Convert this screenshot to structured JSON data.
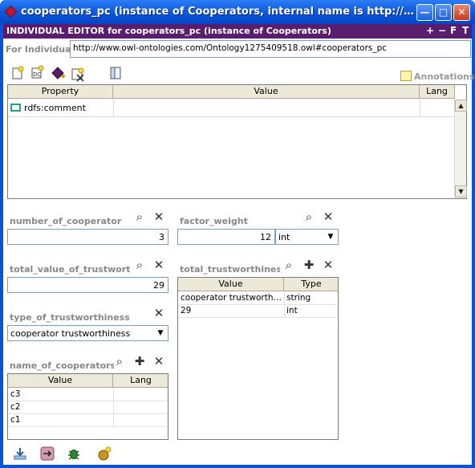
{
  "window": {
    "title": "cooperators_pc   (instance of Cooperators, internal name is http://www.owl-ontologies.com/Ontology1275409518.owl#cooperators_pc)",
    "minimize_glyph": "—",
    "maximize_glyph": "□",
    "close_glyph": "✕"
  },
  "editor": {
    "header_title": "INDIVIDUAL EDITOR for cooperators_pc   (instance of Cooperators)",
    "header_controls": [
      "+",
      "−",
      "F",
      "T"
    ],
    "for_label": "For Individual:",
    "for_value": "http://www.owl-ontologies.com/Ontology1275409518.owl#cooperators_pc",
    "annotations_label": "Annotations"
  },
  "property_table": {
    "columns": [
      "Property",
      "Value",
      "Lang"
    ],
    "rows": [
      {
        "property": "rdfs:comment",
        "value": "",
        "lang": ""
      }
    ]
  },
  "widgets": {
    "number_of_cooperators": {
      "label": "number_of_cooperators",
      "value": "3"
    },
    "factor_weight": {
      "label": "factor_weight",
      "value": "12",
      "type": "int"
    },
    "total_value_of_trustworthiness": {
      "label": "total_value_of_trustworthiness",
      "value": "29"
    },
    "total_trustworthiness": {
      "label": "total_trustworthiness",
      "columns": [
        "Value",
        "Type"
      ],
      "rows": [
        {
          "value": "cooperator trustworthiness",
          "type": "string"
        },
        {
          "value": "29",
          "type": "int"
        }
      ]
    },
    "type_of_trustworthiness": {
      "label": "type_of_trustworthiness",
      "value": "cooperator trustworthiness"
    },
    "name_of_cooperators": {
      "label": "name_of_cooperators",
      "columns": [
        "Value",
        "Lang"
      ],
      "rows": [
        {
          "value": "c3",
          "lang": ""
        },
        {
          "value": "c2",
          "lang": ""
        },
        {
          "value": "c1",
          "lang": ""
        }
      ]
    }
  },
  "glyphs": {
    "find": "⌕",
    "delete": "✕",
    "add": "✚",
    "dropdown": "▼",
    "scroll_up": "▲",
    "scroll_down": "▼"
  },
  "colors": {
    "titlebar": "#0a56dd",
    "editor_header": "#5a1c6c",
    "label_gray": "#888888"
  }
}
